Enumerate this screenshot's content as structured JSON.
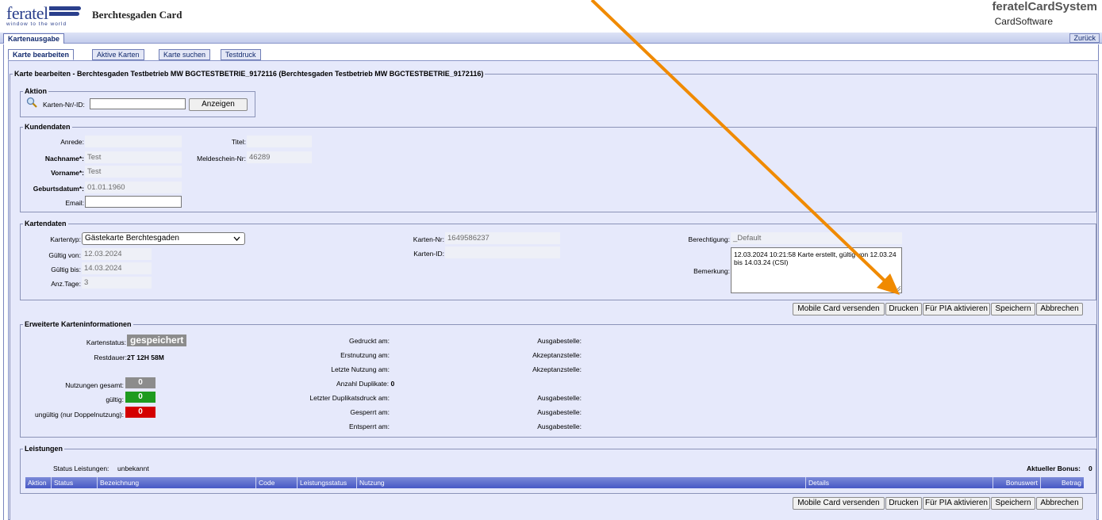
{
  "header": {
    "logo_text": "feratel",
    "logo_subtitle": "window to the world",
    "app_title": "Berchtesgaden Card",
    "brand_title": "feratelCardSystem",
    "brand_subtitle": "CardSoftware"
  },
  "topbar": {
    "active_tab": "Kartenausgabe",
    "back_button": "Zurück"
  },
  "subtabs": [
    "Karte bearbeiten",
    "Aktive Karten",
    "Karte suchen",
    "Testdruck"
  ],
  "main_legend": "Karte bearbeiten - Berchtesgaden Testbetrieb MW BGCTESTBETRIE_9172116 (Berchtesgaden Testbetrieb MW BGCTESTBETRIE_9172116)",
  "aktion": {
    "legend": "Aktion",
    "label": "Karten-Nr/-ID:",
    "input_value": "",
    "button": "Anzeigen"
  },
  "kunden": {
    "legend": "Kundendaten",
    "anrede_label": "Anrede:",
    "anrede": "",
    "nachname_label": "Nachname*:",
    "nachname": "Test",
    "vorname_label": "Vorname*:",
    "vorname": "Test",
    "geburt_label": "Geburtsdatum*:",
    "geburt": "01.01.1960",
    "email_label": "Email:",
    "email": "",
    "titel_label": "Titel:",
    "titel": "",
    "meldeschein_label": "Meldeschein-Nr:",
    "meldeschein": "46289"
  },
  "karten": {
    "legend": "Kartendaten",
    "kartentyp_label": "Kartentyp:",
    "kartentyp": "Gästekarte Berchtesgaden",
    "gueltig_von_label": "Gültig von:",
    "gueltig_von": "12.03.2024",
    "gueltig_bis_label": "Gültig bis:",
    "gueltig_bis": "14.03.2024",
    "tage_label": "Anz.Tage:",
    "tage": "3",
    "nr_label": "Karten-Nr:",
    "nr": "1649586237",
    "id_label": "Karten-ID:",
    "id": "",
    "berechtigung_label": "Berechtigung:",
    "berechtigung": "_Default",
    "bemerkung_label": "Bemerkung:",
    "bemerkung": "12.03.2024 10:21:58 Karte erstellt, gültig von 12.03.24 bis 14.03.24 (CSI)"
  },
  "actions": {
    "mobile": "Mobile Card versenden",
    "drucken": "Drucken",
    "pia": "Für PIA aktivieren",
    "speichern": "Speichern",
    "abbrechen": "Abbrechen"
  },
  "erweitert": {
    "legend": "Erweiterte Karteninformationen",
    "status_label": "Kartenstatus:",
    "status": "gespeichert",
    "restdauer_label": "Restdauer:",
    "restdauer": "2T 12H 58M",
    "nutz_gesamt_label": "Nutzungen gesamt:",
    "nutz_gesamt": "0",
    "gueltig_label": "gültig:",
    "gueltig": "0",
    "ungueltig_label": "ungültig (nur Doppelnutzung):",
    "ungueltig": "0",
    "gedruckt": "Gedruckt am:",
    "erstnutzung": "Erstnutzung am:",
    "letzte": "Letzte Nutzung am:",
    "duplikate_label": "Anzahl Duplikate:",
    "duplikate": "0",
    "letzter_dup": "Letzter Duplikatsdruck am:",
    "gesperrt": "Gesperrt am:",
    "entsperrt": "Entsperrt am:",
    "ausgabestelle": "Ausgabestelle:",
    "akzeptanzstelle": "Akzeptanzstelle:"
  },
  "leistungen": {
    "legend": "Leistungen",
    "status_label": "Status Leistungen:",
    "status": "unbekannt",
    "bonus_label": "Aktueller Bonus:",
    "bonus": "0",
    "columns": [
      "Aktion",
      "Status",
      "Bezeichnung",
      "Code",
      "Leistungsstatus",
      "Nutzung",
      "Details",
      "Bonuswert",
      "Betrag"
    ]
  },
  "colors": {
    "accent": "#f08a00",
    "header_blue": "#4758c5",
    "green": "#1e9b1e",
    "red": "#d40000"
  }
}
